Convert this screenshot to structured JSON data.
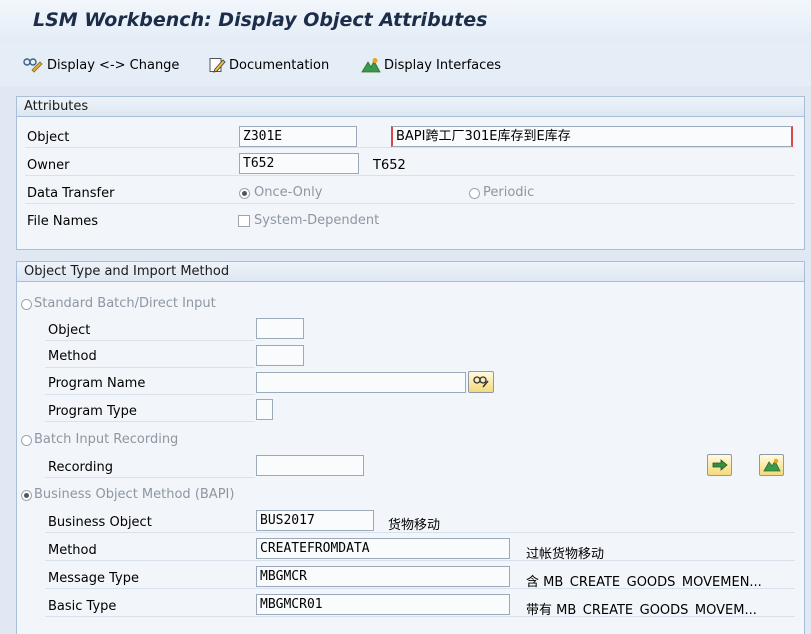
{
  "window": {
    "title": "LSM Workbench: Display Object Attributes"
  },
  "toolbar": {
    "display_change": "Display <-> Change",
    "documentation": "Documentation",
    "display_interfaces": "Display Interfaces"
  },
  "attributes": {
    "header": "Attributes",
    "object_label": "Object",
    "object_value": "Z301E",
    "object_description": "BAPI跨工厂301E库存到E库存",
    "owner_label": "Owner",
    "owner_value": "T652",
    "owner_name": "T652",
    "data_transfer_label": "Data Transfer",
    "once_only": "Once-Only",
    "periodic": "Periodic",
    "data_transfer_selected": "Once-Only",
    "file_names_label": "File Names",
    "system_dependent": "System-Dependent",
    "system_dependent_checked": false
  },
  "import_method": {
    "header": "Object Type and Import Method",
    "standard_batch": "Standard Batch/Direct Input",
    "object_label": "Object",
    "method_label": "Method",
    "program_name_label": "Program Name",
    "program_type_label": "Program Type",
    "batch_input_recording": "Batch Input Recording",
    "recording_label": "Recording",
    "bapi_label": "Business Object Method  (BAPI)",
    "selected": "Business Object Method  (BAPI)",
    "business_object_label": "Business Object",
    "business_object_value": "BUS2017",
    "business_object_desc": "货物移动",
    "method2_label": "Method",
    "method_value": "CREATEFROMDATA",
    "method_desc": "过帐货物移动",
    "message_type_label": "Message Type",
    "message_type_value": "MBGMCR",
    "message_type_desc": "含 MB_CREATE_GOODS_MOVEMEN...",
    "basic_type_label": "Basic Type",
    "basic_type_value": "MBGMCR01",
    "basic_type_desc": "带有 MB_CREATE_GOODS_MOVEM..."
  },
  "colors": {
    "background": "#dfe8f3",
    "group_border": "#a9bfd8",
    "icon_button": "#f5d97a",
    "title_text": "#1b2d49"
  },
  "icons": [
    "display-change-icon",
    "documentation-icon",
    "display-interfaces-icon",
    "possible-entries-icon",
    "transfer-icon",
    "interfaces-icon"
  ]
}
